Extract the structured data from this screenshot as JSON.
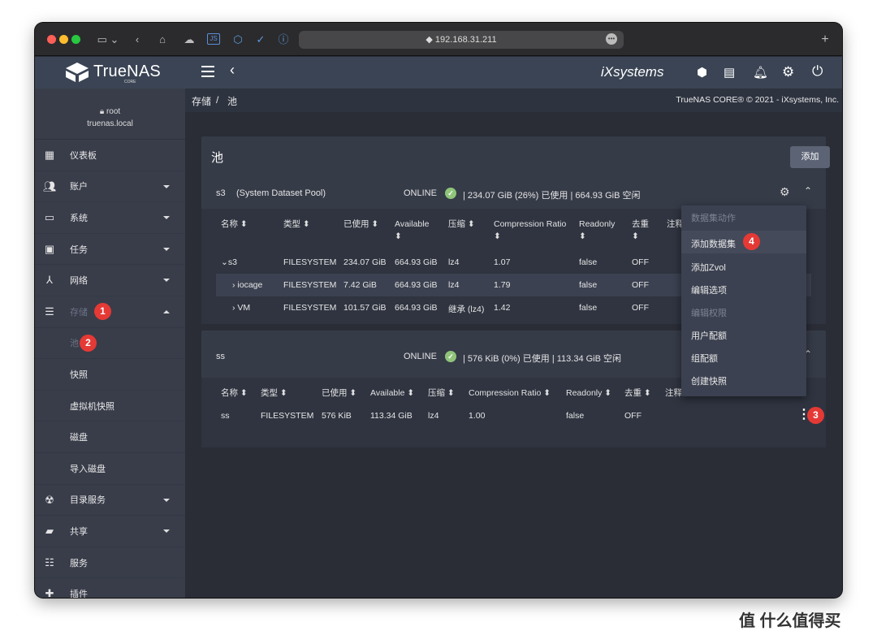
{
  "browser": {
    "url": "192.168.31.211"
  },
  "app": {
    "logo": "TrueNAS",
    "logo_sub": "CORE",
    "vendor": "iXsystems",
    "copyright": "TrueNAS CORE® © 2021 - iXsystems, Inc."
  },
  "user": {
    "name": "root",
    "host": "truenas.local"
  },
  "sidebar": {
    "items": [
      {
        "label": "仪表板"
      },
      {
        "label": "账户"
      },
      {
        "label": "系统"
      },
      {
        "label": "任务"
      },
      {
        "label": "网络"
      },
      {
        "label": "存储"
      },
      {
        "label": "池"
      },
      {
        "label": "快照"
      },
      {
        "label": "虚拟机快照"
      },
      {
        "label": "磁盘"
      },
      {
        "label": "导入磁盘"
      },
      {
        "label": "目录服务"
      },
      {
        "label": "共享"
      },
      {
        "label": "服务"
      },
      {
        "label": "插件"
      }
    ]
  },
  "breadcrumb": {
    "parent": "存储",
    "sep": "/",
    "current": "池"
  },
  "pools": {
    "title": "池",
    "add_button": "添加",
    "pool1": {
      "name": "s3",
      "desc": "(System Dataset Pool)",
      "status": "ONLINE",
      "usage": "| 234.07 GiB (26%) 已使用 | 664.93 GiB 空闲"
    },
    "pool2": {
      "name": "ss",
      "status": "ONLINE",
      "usage": "| 576 KiB (0%) 已使用 | 113.34 GiB 空闲"
    },
    "columns": [
      "名称",
      "类型",
      "已使用",
      "Available",
      "压缩",
      "Compression Ratio",
      "Readonly",
      "去重",
      "注释"
    ],
    "rows1": [
      {
        "name": "s3",
        "type": "FILESYSTEM",
        "used": "234.07 GiB",
        "avail": "664.93 GiB",
        "comp": "lz4",
        "ratio": "1.07",
        "ro": "false",
        "dedup": "OFF"
      },
      {
        "name": "iocage",
        "type": "FILESYSTEM",
        "used": "7.42 GiB",
        "avail": "664.93 GiB",
        "comp": "lz4",
        "ratio": "1.79",
        "ro": "false",
        "dedup": "OFF"
      },
      {
        "name": "VM",
        "type": "FILESYSTEM",
        "used": "101.57 GiB",
        "avail": "664.93 GiB",
        "comp": "继承 (lz4)",
        "ratio": "1.42",
        "ro": "false",
        "dedup": "OFF"
      }
    ],
    "rows2": [
      {
        "name": "ss",
        "type": "FILESYSTEM",
        "used": "576 KiB",
        "avail": "113.34 GiB",
        "comp": "lz4",
        "ratio": "1.00",
        "ro": "false",
        "dedup": "OFF"
      }
    ]
  },
  "menu": {
    "header": "数据集动作",
    "items": [
      "添加数据集",
      "添加Zvol",
      "编辑选项",
      "编辑权限",
      "用户配额",
      "组配额",
      "创建快照"
    ]
  },
  "badges": [
    "1",
    "2",
    "3",
    "4"
  ],
  "watermark": "值 什么值得买",
  "colors": {
    "appbar": "#3a4454",
    "sidebar": "#393d4a",
    "card": "#363b48",
    "online": "#8fc47a",
    "badge": "#e53935"
  }
}
